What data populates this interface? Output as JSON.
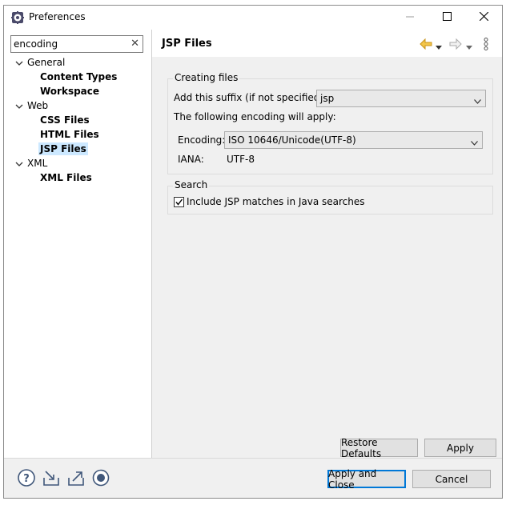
{
  "window": {
    "title": "Preferences",
    "icon": "eclipse-preferences-icon"
  },
  "window_controls": {
    "minimize": "minimize-icon",
    "maximize": "maximize-icon",
    "close": "close-icon"
  },
  "search": {
    "value": "encoding",
    "clear_icon": "clear-icon"
  },
  "tree": [
    {
      "label": "General",
      "expanded": true,
      "children": [
        "Content Types",
        "Workspace"
      ]
    },
    {
      "label": "Web",
      "expanded": true,
      "children": [
        "CSS Files",
        "HTML Files",
        "JSP Files"
      ]
    },
    {
      "label": "XML",
      "expanded": true,
      "children": [
        "XML Files"
      ]
    }
  ],
  "tree_labels": {
    "general": "General",
    "content_types": "Content Types",
    "workspace": "Workspace",
    "web": "Web",
    "css_files": "CSS Files",
    "html_files": "HTML Files",
    "jsp_files": "JSP Files",
    "xml": "XML",
    "xml_files": "XML Files"
  },
  "selected_node": "JSP Files",
  "page": {
    "title": "JSP Files",
    "nav_icons": [
      "back-arrow-icon",
      "back-dropdown-icon",
      "forward-arrow-icon",
      "forward-dropdown-icon",
      "view-menu-icon"
    ],
    "creating_files": {
      "group_label": "Creating files",
      "suffix_label": "Add this suffix (if not specified):",
      "suffix_value": "jsp",
      "encoding_note": "The following encoding will apply:",
      "encoding_label": "Encoding:",
      "encoding_value": "ISO 10646/Unicode(UTF-8)",
      "iana_label": "IANA:",
      "iana_value": "UTF-8"
    },
    "search": {
      "group_label": "Search",
      "include_label": "Include JSP matches in Java searches",
      "include_checked": true
    },
    "restore_defaults": "Restore Defaults",
    "apply": "Apply"
  },
  "footer": {
    "icons": [
      "help-icon",
      "import-icon",
      "export-icon",
      "record-icon"
    ],
    "apply_and_close": "Apply and Close",
    "cancel": "Cancel"
  }
}
